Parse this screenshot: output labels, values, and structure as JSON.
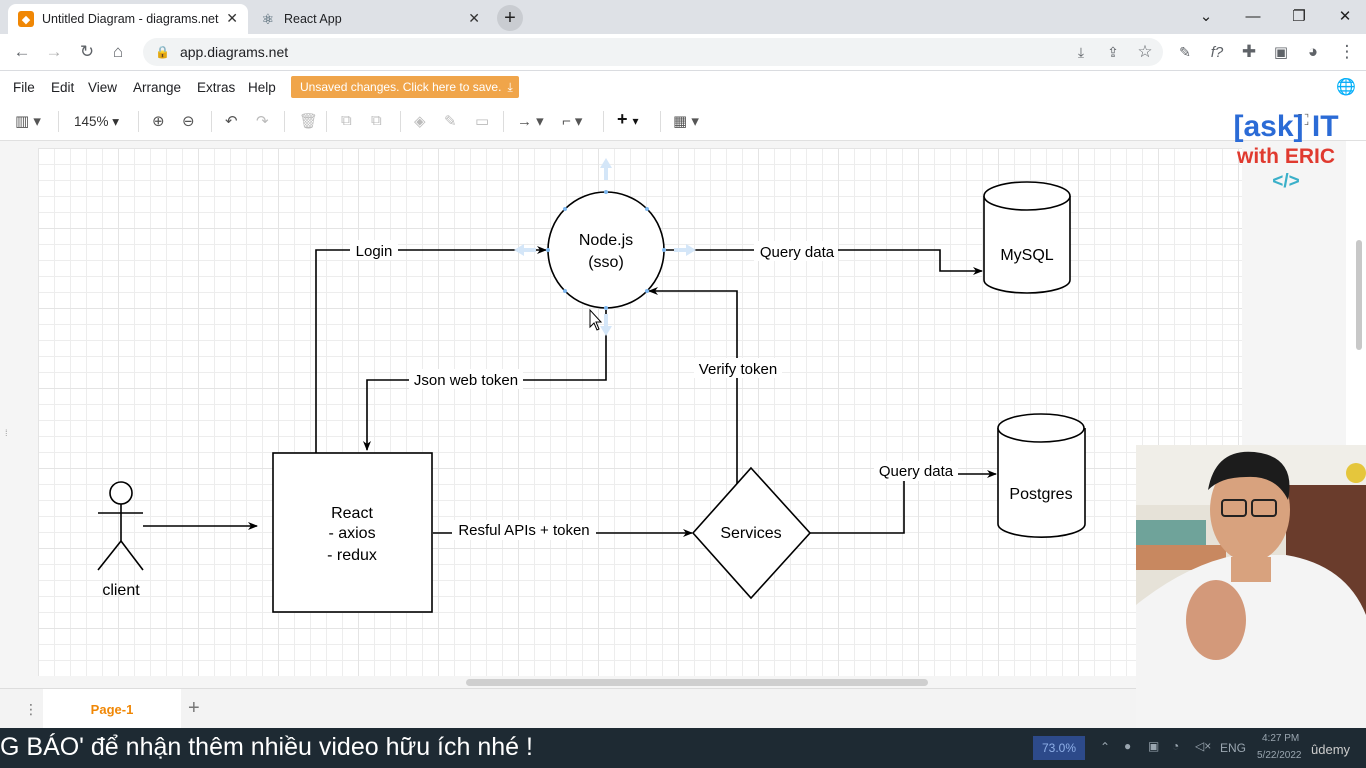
{
  "browser": {
    "tabs": [
      {
        "title": "Untitled Diagram - diagrams.net",
        "icon": "drawio-icon",
        "active": true
      },
      {
        "title": "React App",
        "icon": "react-icon",
        "active": false
      }
    ],
    "url": "app.diagrams.net"
  },
  "app": {
    "menu": [
      "File",
      "Edit",
      "View",
      "Arrange",
      "Extras",
      "Help"
    ],
    "unsaved_notice": "Unsaved changes. Click here to save.",
    "zoom": "145%",
    "page_tab": "Page-1"
  },
  "diagram": {
    "nodes": {
      "nodejs": [
        "Node.js",
        "(sso)"
      ],
      "mysql": "MySQL",
      "postgres": "Postgres",
      "react": [
        "React",
        "- axios",
        "- redux"
      ],
      "services": "Services",
      "client": "client"
    },
    "edges": {
      "login": "Login",
      "query_mysql": "Query data",
      "jwt": "Json web token",
      "verify": "Verify token",
      "rest": "Resful APIs + token",
      "query_postgres": "Query data"
    }
  },
  "overlay": {
    "logo_line1": "[ask] IT",
    "logo_line2": "with ERIC",
    "logo_tag": "</>"
  },
  "video": {
    "caption": "G BÁO' để nhận thêm nhiều video hữu ích nhé !",
    "volume": "73.0%",
    "lang": "ENG",
    "time": "4:27 PM",
    "date": "5/22/2022",
    "brand": "ûdemy"
  },
  "colors": {
    "accent": "#f08705",
    "logo_blue": "#2b6bd6",
    "logo_red": "#e03a2f",
    "logo_teal": "#3bb0c9"
  }
}
